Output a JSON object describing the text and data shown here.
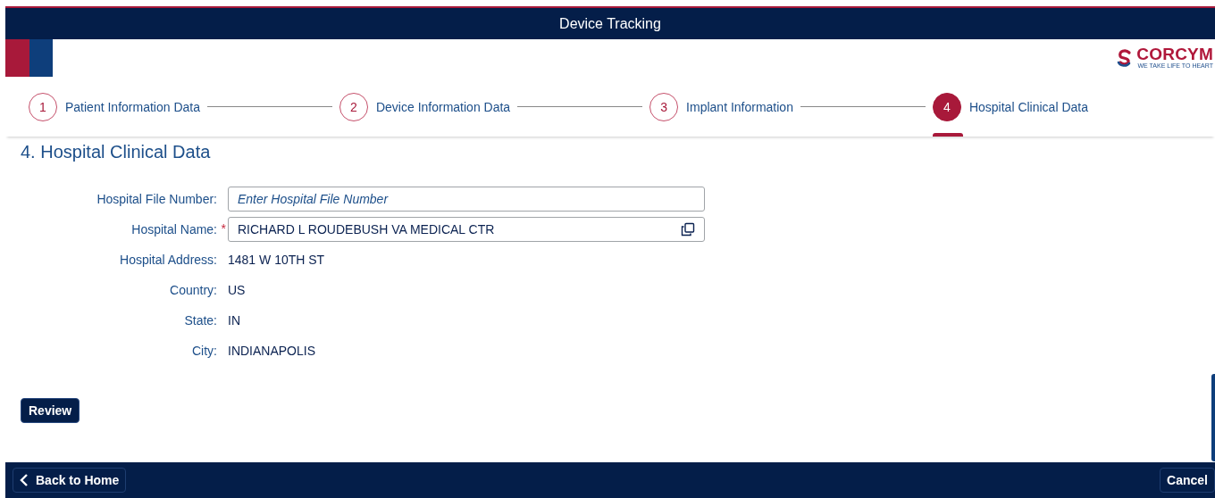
{
  "header": {
    "title": "Device Tracking"
  },
  "logo": {
    "name": "CORCYM",
    "tagline": "WE TAKE LIFE TO HEART"
  },
  "steps": [
    {
      "number": "1",
      "label": "Patient Information Data",
      "selected": false
    },
    {
      "number": "2",
      "label": "Device Information Data",
      "selected": false
    },
    {
      "number": "3",
      "label": "Implant Information",
      "selected": false
    },
    {
      "number": "4",
      "label": "Hospital Clinical Data",
      "selected": true
    }
  ],
  "section": {
    "title": "4. Hospital Clinical Data"
  },
  "fields": [
    {
      "kind": "input",
      "label": "Hospital File Number:",
      "placeholder": "Enter Hospital File Number"
    },
    {
      "kind": "valuehelp",
      "label": "Hospital Name:",
      "required_mark": "*",
      "value": "RICHARD L ROUDEBUSH VA MEDICAL CTR"
    },
    {
      "kind": "text",
      "label": "Hospital Address:",
      "value": "1481 W 10TH ST"
    },
    {
      "kind": "text",
      "label": "Country:",
      "value": "US"
    },
    {
      "kind": "text",
      "label": "State:",
      "value": "IN"
    },
    {
      "kind": "text",
      "label": "City:",
      "value": "INDIANAPOLIS"
    }
  ],
  "review_button": "Review",
  "footer": {
    "back_button": "Back to Home",
    "cancel_button": "Cancel"
  }
}
